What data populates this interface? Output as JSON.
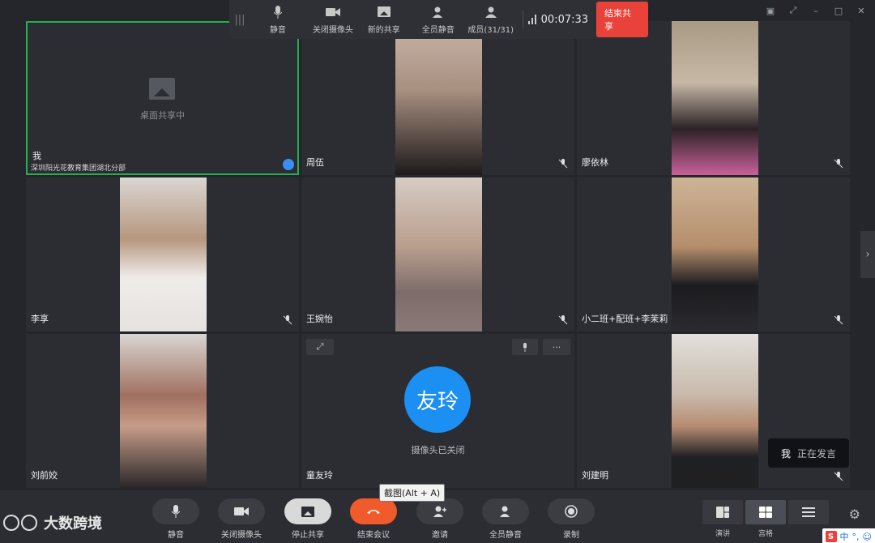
{
  "top_toolbar": {
    "mute": "静音",
    "camera_off": "关闭摄像头",
    "new_share": "新的共享",
    "mute_all": "全员静音",
    "members": "成员(31/31)",
    "timer": "00:07:33",
    "end_share": "结束共享"
  },
  "tiles": {
    "self": {
      "name": "我",
      "org": "深圳阳光花教育集团湖北分部",
      "share_label": "桌面共享中"
    },
    "t2": {
      "name": "周伍"
    },
    "t3": {
      "name": "廖依林"
    },
    "t4": {
      "name": "李享"
    },
    "t5": {
      "name": "王婉怡"
    },
    "t6": {
      "name": "小二班+配班+李茉莉"
    },
    "t7": {
      "name": "刘前姣"
    },
    "t8": {
      "name": "童友玲",
      "avatar_text": "友玲",
      "camera_status": "摄像头已关闭"
    },
    "t9": {
      "name": "刘建明"
    }
  },
  "speaking": {
    "who": "我",
    "status": "正在发言"
  },
  "tooltip": "截图(Alt + A)",
  "bottom_bar": {
    "logo": "大数跨境",
    "mute": "静音",
    "camera_off": "关闭摄像头",
    "stop_share": "停止共享",
    "end_meeting": "结束会议",
    "invite": "邀请",
    "mute_all": "全员静音",
    "record": "录制",
    "layout_speaker": "演讲",
    "layout_gallery": "宫格"
  },
  "ime": {
    "lang": "中",
    "punct": "°,"
  },
  "colors": {
    "accent_green": "#22b24c",
    "end_red": "#e9423b",
    "end_meeting_orange": "#f15a2b",
    "avatar_blue": "#1b8ff2"
  }
}
